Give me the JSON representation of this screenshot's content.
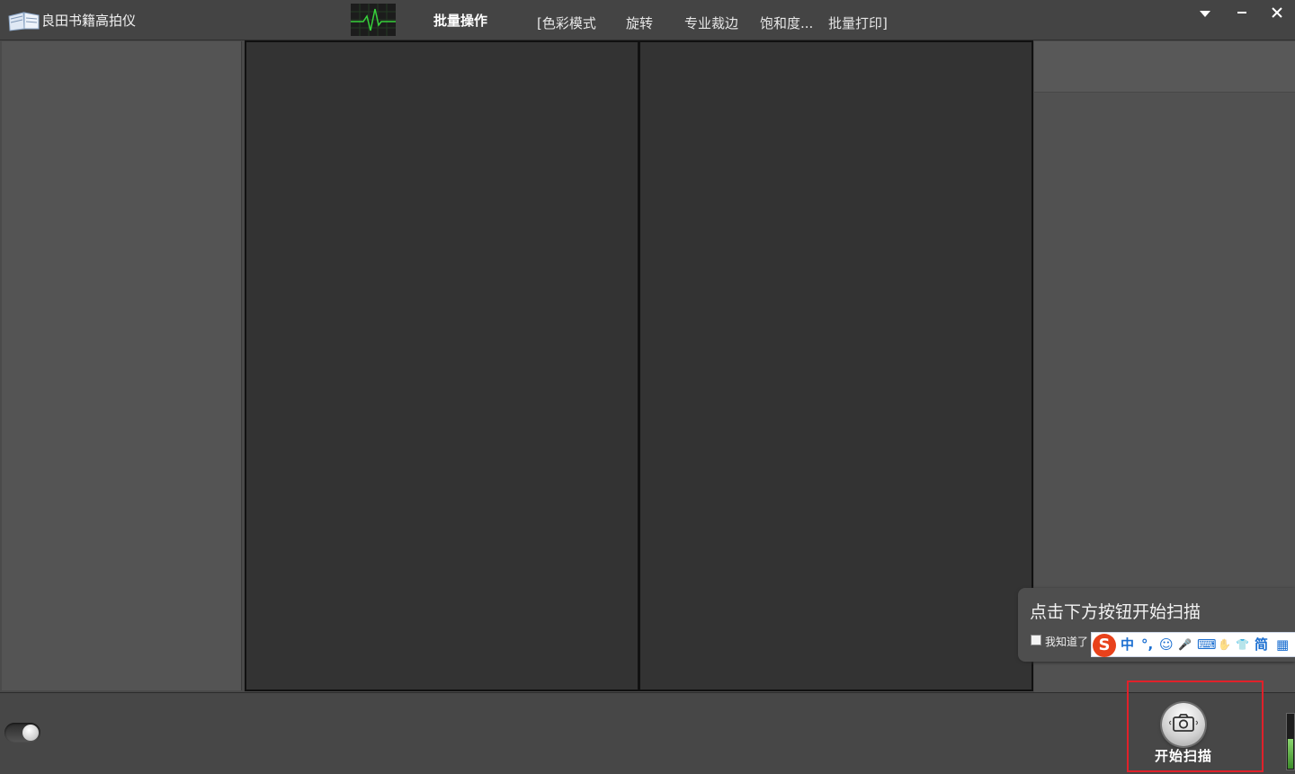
{
  "titlebar": {
    "app_title": "良田书籍高拍仪",
    "menu_batch": "批量操作",
    "menus": [
      "[色彩模式",
      "旋转",
      "专业裁边",
      "饱和度...",
      "批量打印]"
    ],
    "window_controls": [
      "dropdown-icon",
      "minimize-icon",
      "close-icon"
    ]
  },
  "tooltip": {
    "text": "点击下方按钮开始扫描",
    "checkbox_label": "我知道了"
  },
  "ime": {
    "logo": "S",
    "items": [
      "中",
      "°,",
      "☺",
      "🎤",
      "⌨",
      "✋",
      "👕",
      "简",
      "▦"
    ]
  },
  "bottombar": {
    "scan_label": "开始扫描",
    "toggle_on": true,
    "level_meter_fraction": 0.55
  },
  "colors": {
    "background": "#4a4a4a",
    "viewer_page": "#333333",
    "highlight_border": "#e0212a",
    "ime_accent": "#1b6fd1"
  }
}
